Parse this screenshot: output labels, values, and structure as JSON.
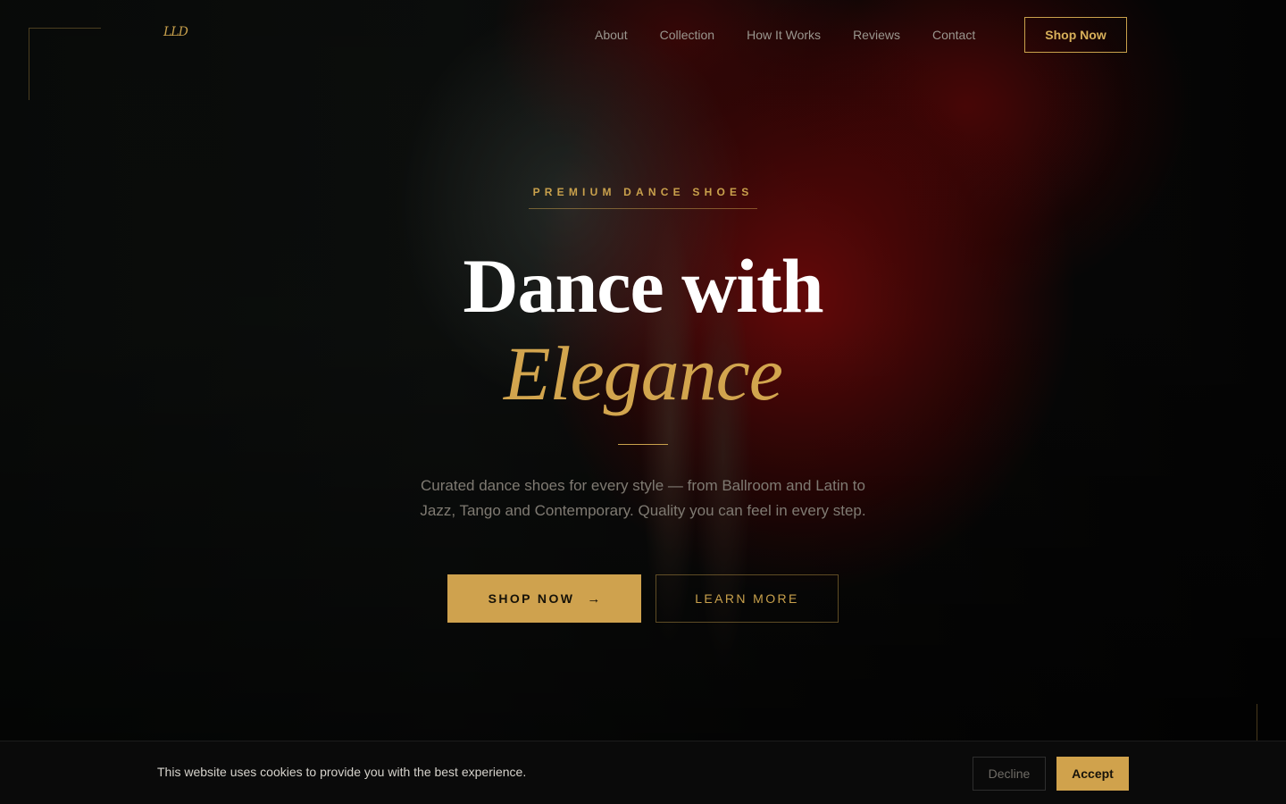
{
  "brand": {
    "logo": "LLD"
  },
  "nav": {
    "items": [
      "About",
      "Collection",
      "How It Works",
      "Reviews",
      "Contact"
    ],
    "cta": "Shop Now"
  },
  "hero": {
    "eyebrow": "PREMIUM DANCE SHOES",
    "title_line1": "Dance with",
    "title_line2": "Elegance",
    "subtitle_line1": "Curated dance shoes for every style — from Ballroom and Latin to",
    "subtitle_line2": "Jazz, Tango and Contemporary. Quality you can feel in every step.",
    "primary_button": "SHOP NOW",
    "primary_icon": "→",
    "secondary_button": "LEARN MORE"
  },
  "cookie": {
    "message": "This website uses cookies to provide you with the best experience.",
    "decline": "Decline",
    "accept": "Accept"
  },
  "colors": {
    "accent_gold": "#c9a14c",
    "background": "#0a0b0a",
    "dress_red": "#960c0c"
  }
}
